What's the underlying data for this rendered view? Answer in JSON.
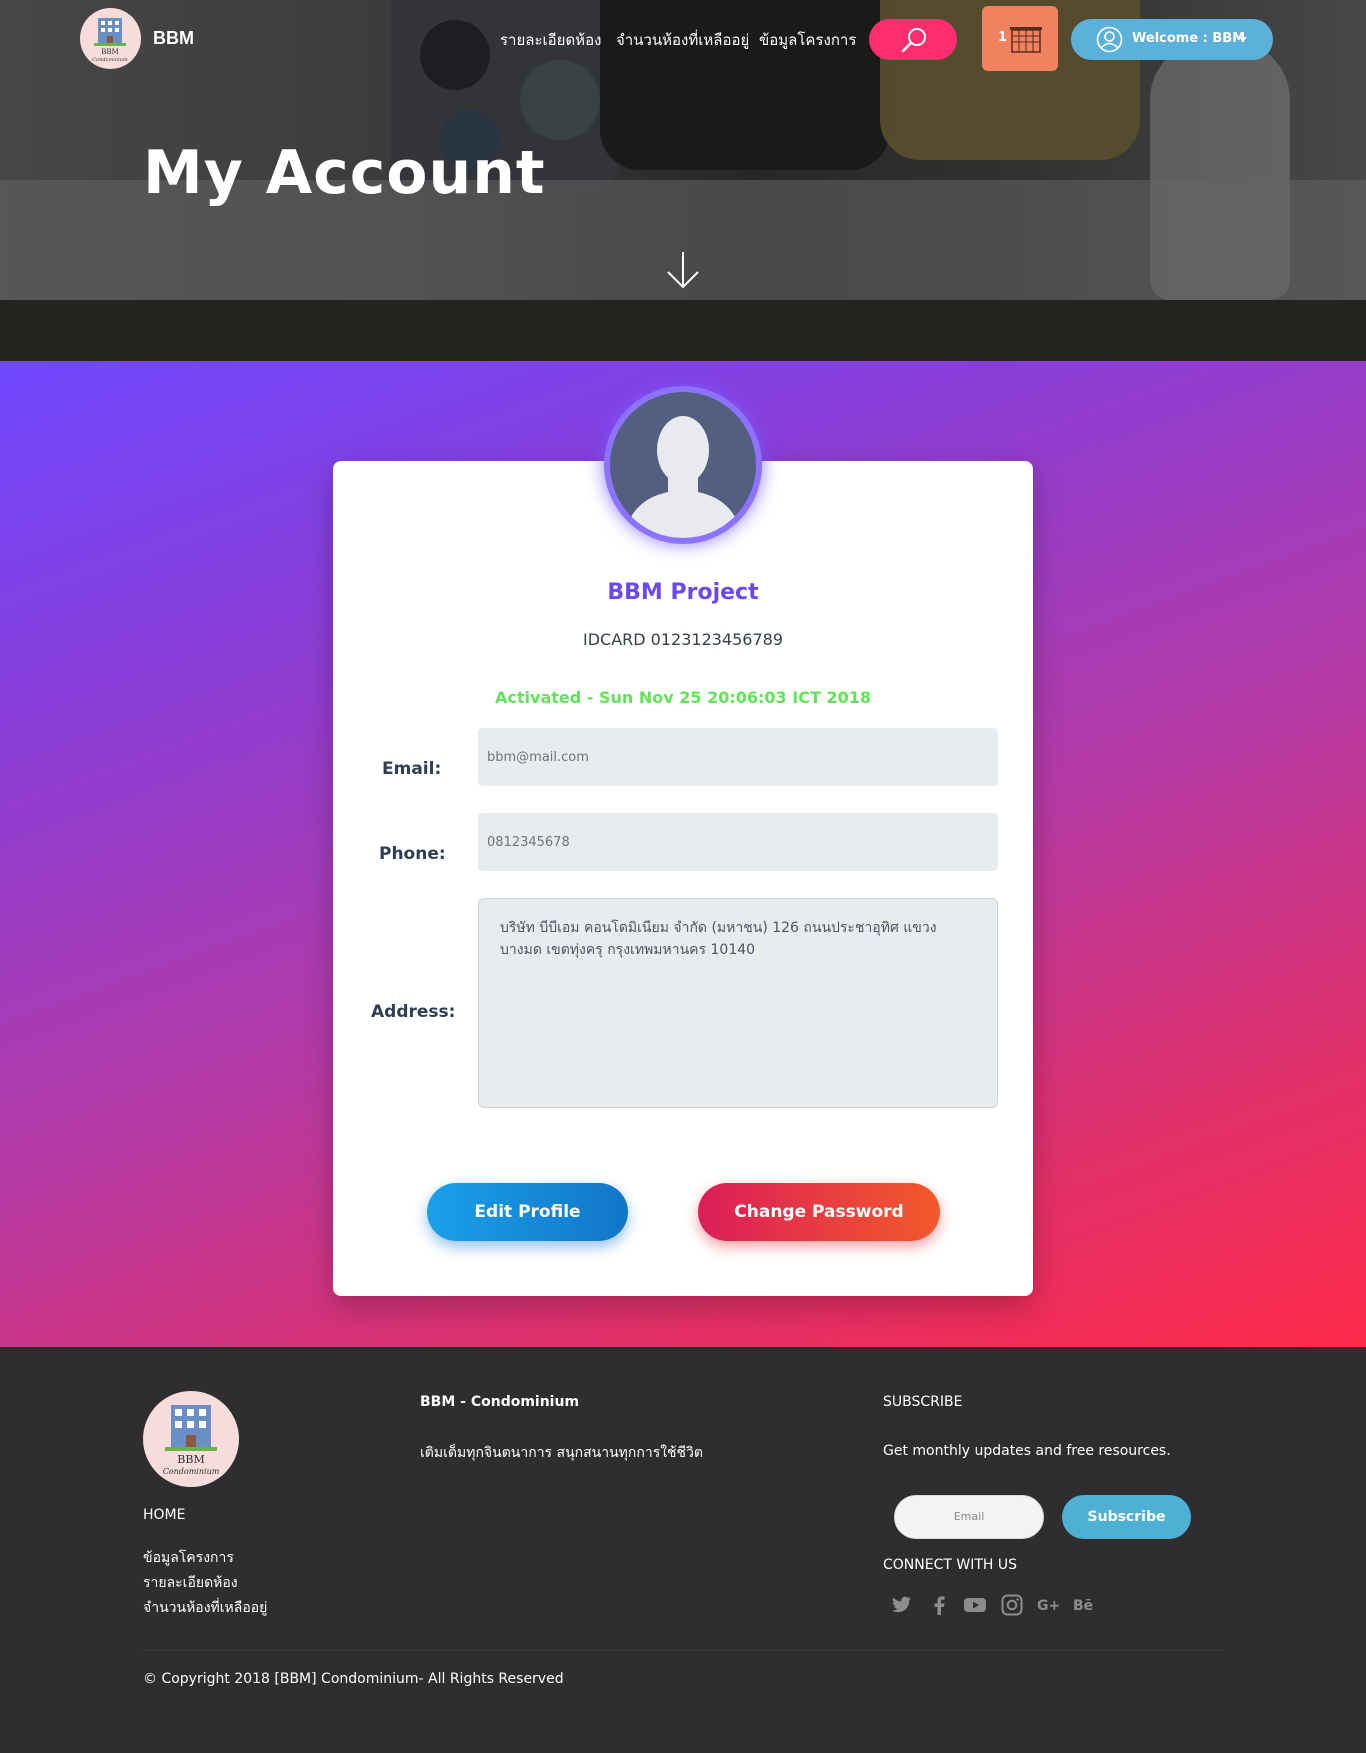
{
  "nav": {
    "brand": "BBM",
    "links": [
      "รายละเอียดห้อง",
      "จำนวนห้องที่เหลืออยู่",
      "ข้อมูลโครงการ"
    ],
    "cart_count": "1",
    "welcome": "Welcome : BBM"
  },
  "hero": {
    "title": "My Account"
  },
  "profile": {
    "name": "BBM Project",
    "idcard": "IDCARD 0123123456789",
    "activated": "Activated - Sun Nov 25 20:06:03 ICT 2018",
    "email_label": "Email:",
    "email_placeholder": "bbm@mail.com",
    "phone_label": "Phone:",
    "phone_placeholder": "0812345678",
    "address_label": "Address:",
    "address_value": "บริษัท บีบีเอม คอนโดมิเนียม จำกัด (มหาชน) 126 ถนนประชาอุทิศ แขวงบางมด เขตทุ่งครุ กรุงเทพมหานคร 10140",
    "edit_button": "Edit Profile",
    "change_password_button": "Change Password"
  },
  "footer": {
    "home": "HOME",
    "links": [
      "ข้อมูลโครงการ",
      "รายละเอียดห้อง",
      "จำนวนห้องที่เหลืออยู่"
    ],
    "company_title": "BBM - Condominium",
    "tagline": "เติมเต็มทุกจินตนาการ สนุกสนานทุกการใช้ชีวิต",
    "subscribe_title": "SUBSCRIBE",
    "subscribe_text": "Get monthly updates and free resources.",
    "email_placeholder": "Email",
    "subscribe_button": "Subscribe",
    "connect_title": "CONNECT WITH US",
    "social_icons": [
      "twitter-icon",
      "facebook-icon",
      "youtube-icon",
      "instagram-icon",
      "google-plus-icon",
      "behance-icon"
    ],
    "copyright": "© Copyright 2018 [BBM] Condominium- All Rights Reserved"
  },
  "colors": {
    "accent_purple": "#6b48f2",
    "activated_green": "#62e35a",
    "search_pink": "#ff2d6f",
    "welcome_blue": "#5bb1d9",
    "cart_orange": "#f0825f"
  }
}
